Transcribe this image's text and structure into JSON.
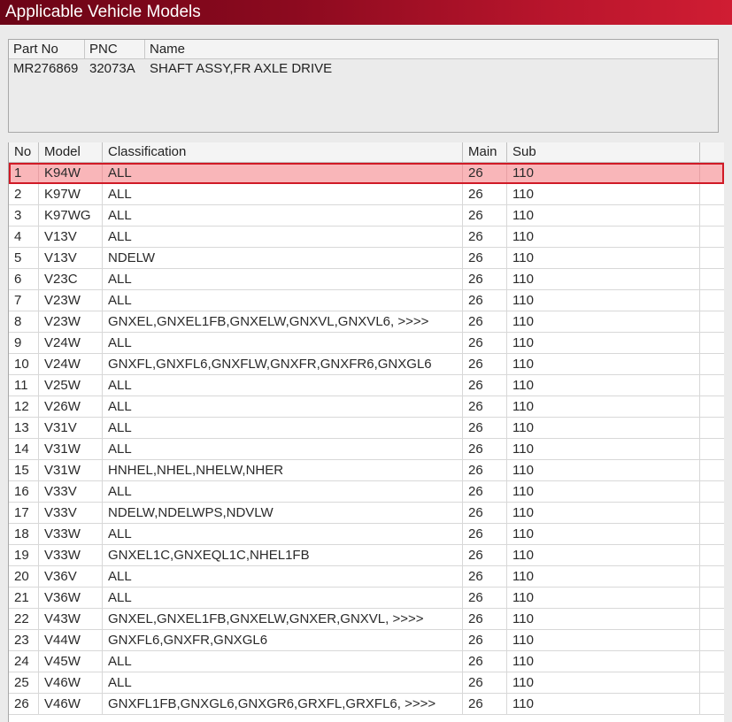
{
  "window": {
    "title": "Applicable Vehicle Models"
  },
  "part": {
    "headers": {
      "part_no": "Part No",
      "pnc": "PNC",
      "name": "Name"
    },
    "part_no": "MR276869",
    "pnc": "32073A",
    "name": "SHAFT ASSY,FR AXLE DRIVE"
  },
  "grid": {
    "headers": {
      "no": "No",
      "model": "Model",
      "classification": "Classification",
      "main": "Main",
      "sub": "Sub"
    },
    "selected_index": 0,
    "rows": [
      {
        "no": "1",
        "model": "K94W",
        "classification": "ALL",
        "main": "26",
        "sub": "110"
      },
      {
        "no": "2",
        "model": "K97W",
        "classification": "ALL",
        "main": "26",
        "sub": "110"
      },
      {
        "no": "3",
        "model": "K97WG",
        "classification": "ALL",
        "main": "26",
        "sub": "110"
      },
      {
        "no": "4",
        "model": "V13V",
        "classification": "ALL",
        "main": "26",
        "sub": "110"
      },
      {
        "no": "5",
        "model": "V13V",
        "classification": "NDELW",
        "main": "26",
        "sub": "110"
      },
      {
        "no": "6",
        "model": "V23C",
        "classification": "ALL",
        "main": "26",
        "sub": "110"
      },
      {
        "no": "7",
        "model": "V23W",
        "classification": "ALL",
        "main": "26",
        "sub": "110"
      },
      {
        "no": "8",
        "model": "V23W",
        "classification": "GNXEL,GNXEL1FB,GNXELW,GNXVL,GNXVL6,  >>>>",
        "main": "26",
        "sub": "110"
      },
      {
        "no": "9",
        "model": "V24W",
        "classification": "ALL",
        "main": "26",
        "sub": "110"
      },
      {
        "no": "10",
        "model": "V24W",
        "classification": "GNXFL,GNXFL6,GNXFLW,GNXFR,GNXFR6,GNXGL6",
        "main": "26",
        "sub": "110"
      },
      {
        "no": "11",
        "model": "V25W",
        "classification": "ALL",
        "main": "26",
        "sub": "110"
      },
      {
        "no": "12",
        "model": "V26W",
        "classification": "ALL",
        "main": "26",
        "sub": "110"
      },
      {
        "no": "13",
        "model": "V31V",
        "classification": "ALL",
        "main": "26",
        "sub": "110"
      },
      {
        "no": "14",
        "model": "V31W",
        "classification": "ALL",
        "main": "26",
        "sub": "110"
      },
      {
        "no": "15",
        "model": "V31W",
        "classification": "HNHEL,NHEL,NHELW,NHER",
        "main": "26",
        "sub": "110"
      },
      {
        "no": "16",
        "model": "V33V",
        "classification": "ALL",
        "main": "26",
        "sub": "110"
      },
      {
        "no": "17",
        "model": "V33V",
        "classification": "NDELW,NDELWPS,NDVLW",
        "main": "26",
        "sub": "110"
      },
      {
        "no": "18",
        "model": "V33W",
        "classification": "ALL",
        "main": "26",
        "sub": "110"
      },
      {
        "no": "19",
        "model": "V33W",
        "classification": "GNXEL1C,GNXEQL1C,NHEL1FB",
        "main": "26",
        "sub": "110"
      },
      {
        "no": "20",
        "model": "V36V",
        "classification": "ALL",
        "main": "26",
        "sub": "110"
      },
      {
        "no": "21",
        "model": "V36W",
        "classification": "ALL",
        "main": "26",
        "sub": "110"
      },
      {
        "no": "22",
        "model": "V43W",
        "classification": "GNXEL,GNXEL1FB,GNXELW,GNXER,GNXVL,  >>>>",
        "main": "26",
        "sub": "110"
      },
      {
        "no": "23",
        "model": "V44W",
        "classification": "GNXFL6,GNXFR,GNXGL6",
        "main": "26",
        "sub": "110"
      },
      {
        "no": "24",
        "model": "V45W",
        "classification": "ALL",
        "main": "26",
        "sub": "110"
      },
      {
        "no": "25",
        "model": "V46W",
        "classification": "ALL",
        "main": "26",
        "sub": "110"
      },
      {
        "no": "26",
        "model": "V46W",
        "classification": "GNXFL1FB,GNXGL6,GNXGR6,GRXFL,GRXFL6,  >>>>",
        "main": "26",
        "sub": "110"
      }
    ]
  },
  "colors": {
    "title_start": "#6b0416",
    "title_end": "#d01d33",
    "selected_fill": "#f9b6b9",
    "selected_border": "#d01a26"
  }
}
